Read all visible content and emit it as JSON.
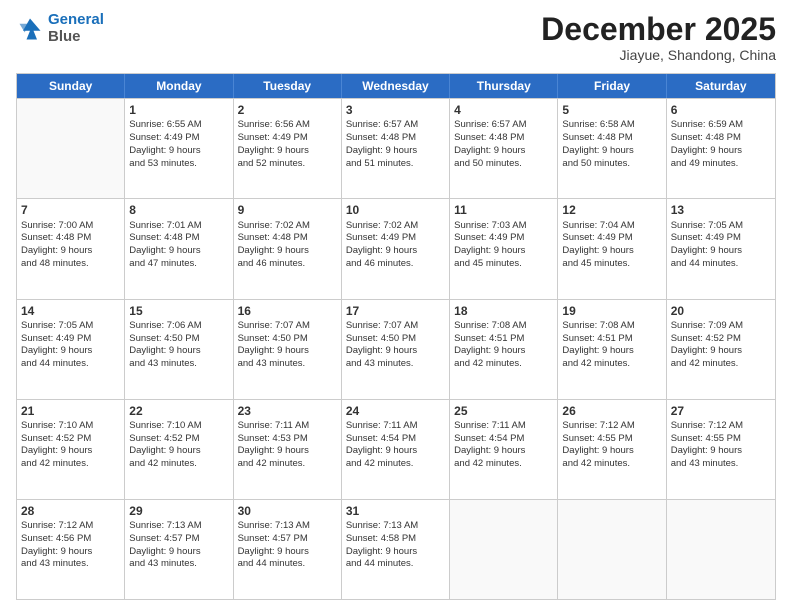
{
  "header": {
    "logo_line1": "General",
    "logo_line2": "Blue",
    "month_title": "December 2025",
    "subtitle": "Jiayue, Shandong, China"
  },
  "days_of_week": [
    "Sunday",
    "Monday",
    "Tuesday",
    "Wednesday",
    "Thursday",
    "Friday",
    "Saturday"
  ],
  "weeks": [
    [
      {
        "day": null,
        "info": null
      },
      {
        "day": "1",
        "info": "Sunrise: 6:55 AM\nSunset: 4:49 PM\nDaylight: 9 hours\nand 53 minutes."
      },
      {
        "day": "2",
        "info": "Sunrise: 6:56 AM\nSunset: 4:49 PM\nDaylight: 9 hours\nand 52 minutes."
      },
      {
        "day": "3",
        "info": "Sunrise: 6:57 AM\nSunset: 4:48 PM\nDaylight: 9 hours\nand 51 minutes."
      },
      {
        "day": "4",
        "info": "Sunrise: 6:57 AM\nSunset: 4:48 PM\nDaylight: 9 hours\nand 50 minutes."
      },
      {
        "day": "5",
        "info": "Sunrise: 6:58 AM\nSunset: 4:48 PM\nDaylight: 9 hours\nand 50 minutes."
      },
      {
        "day": "6",
        "info": "Sunrise: 6:59 AM\nSunset: 4:48 PM\nDaylight: 9 hours\nand 49 minutes."
      }
    ],
    [
      {
        "day": "7",
        "info": "Sunrise: 7:00 AM\nSunset: 4:48 PM\nDaylight: 9 hours\nand 48 minutes."
      },
      {
        "day": "8",
        "info": "Sunrise: 7:01 AM\nSunset: 4:48 PM\nDaylight: 9 hours\nand 47 minutes."
      },
      {
        "day": "9",
        "info": "Sunrise: 7:02 AM\nSunset: 4:48 PM\nDaylight: 9 hours\nand 46 minutes."
      },
      {
        "day": "10",
        "info": "Sunrise: 7:02 AM\nSunset: 4:49 PM\nDaylight: 9 hours\nand 46 minutes."
      },
      {
        "day": "11",
        "info": "Sunrise: 7:03 AM\nSunset: 4:49 PM\nDaylight: 9 hours\nand 45 minutes."
      },
      {
        "day": "12",
        "info": "Sunrise: 7:04 AM\nSunset: 4:49 PM\nDaylight: 9 hours\nand 45 minutes."
      },
      {
        "day": "13",
        "info": "Sunrise: 7:05 AM\nSunset: 4:49 PM\nDaylight: 9 hours\nand 44 minutes."
      }
    ],
    [
      {
        "day": "14",
        "info": "Sunrise: 7:05 AM\nSunset: 4:49 PM\nDaylight: 9 hours\nand 44 minutes."
      },
      {
        "day": "15",
        "info": "Sunrise: 7:06 AM\nSunset: 4:50 PM\nDaylight: 9 hours\nand 43 minutes."
      },
      {
        "day": "16",
        "info": "Sunrise: 7:07 AM\nSunset: 4:50 PM\nDaylight: 9 hours\nand 43 minutes."
      },
      {
        "day": "17",
        "info": "Sunrise: 7:07 AM\nSunset: 4:50 PM\nDaylight: 9 hours\nand 43 minutes."
      },
      {
        "day": "18",
        "info": "Sunrise: 7:08 AM\nSunset: 4:51 PM\nDaylight: 9 hours\nand 42 minutes."
      },
      {
        "day": "19",
        "info": "Sunrise: 7:08 AM\nSunset: 4:51 PM\nDaylight: 9 hours\nand 42 minutes."
      },
      {
        "day": "20",
        "info": "Sunrise: 7:09 AM\nSunset: 4:52 PM\nDaylight: 9 hours\nand 42 minutes."
      }
    ],
    [
      {
        "day": "21",
        "info": "Sunrise: 7:10 AM\nSunset: 4:52 PM\nDaylight: 9 hours\nand 42 minutes."
      },
      {
        "day": "22",
        "info": "Sunrise: 7:10 AM\nSunset: 4:52 PM\nDaylight: 9 hours\nand 42 minutes."
      },
      {
        "day": "23",
        "info": "Sunrise: 7:11 AM\nSunset: 4:53 PM\nDaylight: 9 hours\nand 42 minutes."
      },
      {
        "day": "24",
        "info": "Sunrise: 7:11 AM\nSunset: 4:54 PM\nDaylight: 9 hours\nand 42 minutes."
      },
      {
        "day": "25",
        "info": "Sunrise: 7:11 AM\nSunset: 4:54 PM\nDaylight: 9 hours\nand 42 minutes."
      },
      {
        "day": "26",
        "info": "Sunrise: 7:12 AM\nSunset: 4:55 PM\nDaylight: 9 hours\nand 42 minutes."
      },
      {
        "day": "27",
        "info": "Sunrise: 7:12 AM\nSunset: 4:55 PM\nDaylight: 9 hours\nand 43 minutes."
      }
    ],
    [
      {
        "day": "28",
        "info": "Sunrise: 7:12 AM\nSunset: 4:56 PM\nDaylight: 9 hours\nand 43 minutes."
      },
      {
        "day": "29",
        "info": "Sunrise: 7:13 AM\nSunset: 4:57 PM\nDaylight: 9 hours\nand 43 minutes."
      },
      {
        "day": "30",
        "info": "Sunrise: 7:13 AM\nSunset: 4:57 PM\nDaylight: 9 hours\nand 44 minutes."
      },
      {
        "day": "31",
        "info": "Sunrise: 7:13 AM\nSunset: 4:58 PM\nDaylight: 9 hours\nand 44 minutes."
      },
      {
        "day": null,
        "info": null
      },
      {
        "day": null,
        "info": null
      },
      {
        "day": null,
        "info": null
      }
    ]
  ]
}
